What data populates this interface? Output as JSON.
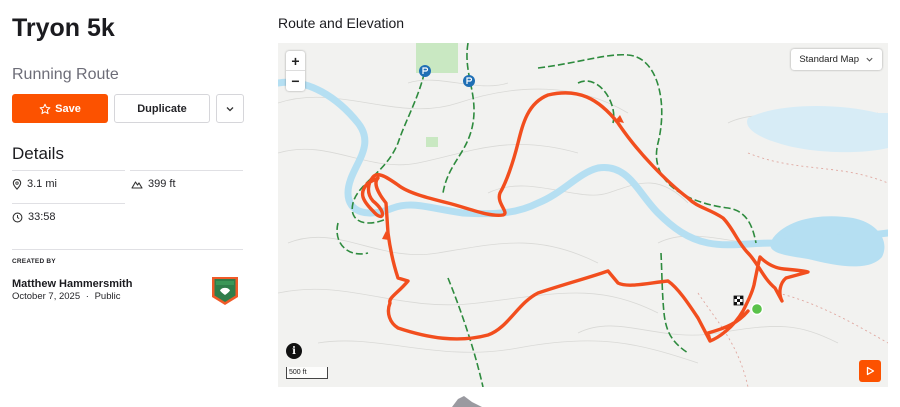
{
  "route": {
    "title": "Tryon 5k",
    "type": "Running Route"
  },
  "actions": {
    "save_label": "Save",
    "duplicate_label": "Duplicate"
  },
  "details": {
    "heading": "Details",
    "distance": "3.1 mi",
    "elevation": "399 ft",
    "time": "33:58"
  },
  "creator": {
    "label": "CREATED BY",
    "name": "Matthew Hammersmith",
    "date": "October 7, 2025",
    "visibility": "Public",
    "separator": "·"
  },
  "map": {
    "heading": "Route and Elevation",
    "style_label": "Standard Map",
    "scale_label": "500 ft",
    "zoom_in": "+",
    "zoom_out": "−",
    "info": "i"
  },
  "colors": {
    "brand": "#fc5200",
    "route": "#f24e1e",
    "water": "#b5dff2",
    "trail": "#2e8b3e",
    "start": "#5ac24a"
  },
  "icons": [
    "star-icon",
    "chevron-down-icon",
    "pin-icon",
    "mountain-icon",
    "clock-icon",
    "badge-icon",
    "play-icon",
    "finish-flag-icon"
  ]
}
